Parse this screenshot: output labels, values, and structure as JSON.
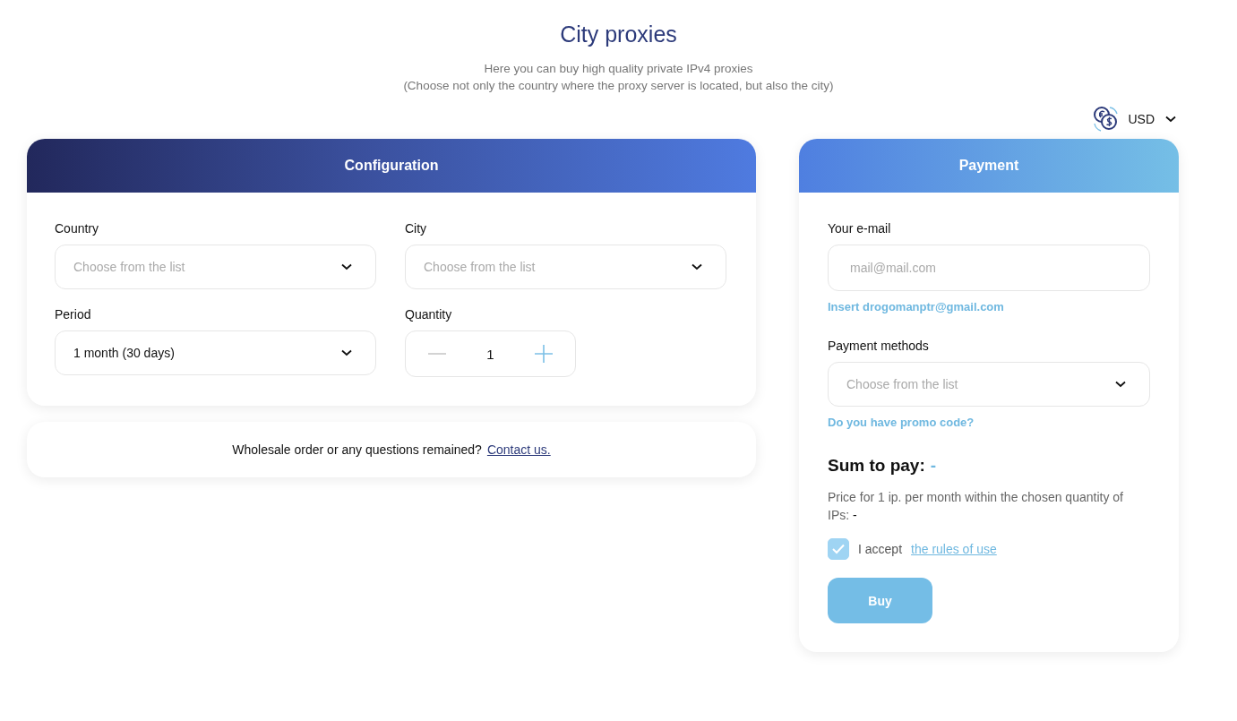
{
  "title": "City proxies",
  "subtitle_lines": [
    "Here you can buy high quality private IPv4 proxies",
    "(Choose not only the country where the proxy server is located, but also the city)"
  ],
  "currency": {
    "value": "USD"
  },
  "configuration": {
    "title": "Configuration",
    "fields": [
      {
        "kind": "select",
        "label": "Country",
        "placeholder": "Choose from the list"
      },
      {
        "kind": "select",
        "label": "City",
        "placeholder": "Choose from the list"
      },
      {
        "kind": "select",
        "label": "Period",
        "value": "1 month (30 days)"
      },
      {
        "kind": "stepper",
        "label": "Quantity",
        "value": "1"
      }
    ]
  },
  "contact": {
    "text": "Wholesale order or any questions remained?",
    "link": "Contact us."
  },
  "payment": {
    "title": "Payment",
    "email": {
      "label": "Your e-mail",
      "placeholder": "mail@mail.com"
    },
    "insert_link": "Insert drogomanptr@gmail.com",
    "methods": {
      "label": "Payment methods",
      "placeholder": "Choose from the list"
    },
    "promo_link": "Do you have promo code?",
    "sum": {
      "label": "Sum to pay:",
      "value": "-"
    },
    "price_note": "Price for 1 ip. per month within the chosen quantity of IPs:",
    "price_value": "-",
    "accept": {
      "checked": true,
      "text": "I accept",
      "link": "the rules of use"
    },
    "buy_button": "Buy"
  }
}
